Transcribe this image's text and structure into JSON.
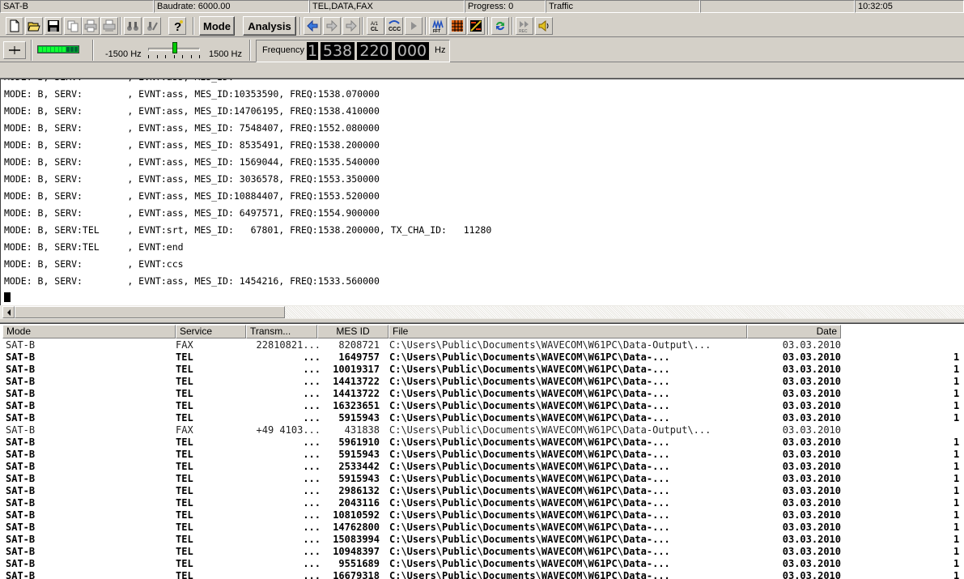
{
  "status": {
    "mode": "SAT-B",
    "baudrate": "Baudrate: 6000.00",
    "services": "TEL,DATA,FAX",
    "progress": "Progress: 0",
    "traffic": "Traffic",
    "blank": "",
    "time": "10:32:05"
  },
  "toolbar": {
    "mode_label": "Mode",
    "analysis_label": "Analysis",
    "icons": [
      "new-file-icon",
      "open-folder-icon",
      "save-icon",
      "copy-icon",
      "print-icon",
      "print-setup-icon",
      "binoculars-icon",
      "find-next-icon",
      "help-icon",
      "arrow-left-icon",
      "arrow-right-icon",
      "clear-icon",
      "ccc-icon",
      "play-icon",
      "fft-icon",
      "grid-icon",
      "sync-icon",
      "refresh-icon",
      "rec-icon",
      "speaker-icon"
    ]
  },
  "tuning": {
    "min_hz": "-1500 Hz",
    "max_hz": "1500 Hz",
    "offset_level": 0.52,
    "signal_level": 0.7,
    "frequency_label": "Frequency",
    "digits": [
      "1",
      "538",
      "220",
      "000"
    ],
    "unit": "Hz"
  },
  "output": {
    "lines": [
      "MODE: B, SERV:        , EVNT:ass, MES_ID:10353590, FREQ:1538.070000",
      "MODE: B, SERV:        , EVNT:ass, MES_ID:14706195, FREQ:1538.410000",
      "MODE: B, SERV:        , EVNT:ass, MES_ID: 7548407, FREQ:1552.080000",
      "MODE: B, SERV:        , EVNT:ass, MES_ID: 8535491, FREQ:1538.200000",
      "MODE: B, SERV:        , EVNT:ass, MES_ID: 1569044, FREQ:1535.540000",
      "MODE: B, SERV:        , EVNT:ass, MES_ID: 3036578, FREQ:1553.350000",
      "MODE: B, SERV:        , EVNT:ass, MES_ID:10884407, FREQ:1553.520000",
      "MODE: B, SERV:        , EVNT:ass, MES_ID: 6497571, FREQ:1554.900000",
      "MODE: B, SERV:TEL     , EVNT:srt, MES_ID:   67801, FREQ:1538.200000, TX_CHA_ID:   11280",
      "MODE: B, SERV:TEL     , EVNT:end",
      "MODE: B, SERV:        , EVNT:ccs",
      "MODE: B, SERV:        , EVNT:ass, MES_ID: 1454216, FREQ:1533.560000"
    ]
  },
  "table": {
    "columns": [
      "Mode",
      "Service",
      "Transm...",
      "MES ID",
      "File",
      "Date"
    ],
    "rows": [
      {
        "mode": "SAT-B",
        "service": "FAX",
        "trans": "22810821...",
        "mes": "8208721",
        "file": "C:\\Users\\Public\\Documents\\WAVECOM\\W61PC\\Data-Output\\...",
        "date": "03.03.2010",
        "extra": "",
        "bold": false
      },
      {
        "mode": "SAT-B",
        "service": "TEL",
        "trans": "...",
        "mes": "1649757",
        "file": "C:\\Users\\Public\\Documents\\WAVECOM\\W61PC\\Data-...",
        "date": "03.03.2010",
        "extra": "1",
        "bold": true
      },
      {
        "mode": "SAT-B",
        "service": "TEL",
        "trans": "...",
        "mes": "10019317",
        "file": "C:\\Users\\Public\\Documents\\WAVECOM\\W61PC\\Data-...",
        "date": "03.03.2010",
        "extra": "1",
        "bold": true
      },
      {
        "mode": "SAT-B",
        "service": "TEL",
        "trans": "...",
        "mes": "14413722",
        "file": "C:\\Users\\Public\\Documents\\WAVECOM\\W61PC\\Data-...",
        "date": "03.03.2010",
        "extra": "1",
        "bold": true
      },
      {
        "mode": "SAT-B",
        "service": "TEL",
        "trans": "...",
        "mes": "14413722",
        "file": "C:\\Users\\Public\\Documents\\WAVECOM\\W61PC\\Data-...",
        "date": "03.03.2010",
        "extra": "1",
        "bold": true
      },
      {
        "mode": "SAT-B",
        "service": "TEL",
        "trans": "...",
        "mes": "16323651",
        "file": "C:\\Users\\Public\\Documents\\WAVECOM\\W61PC\\Data-...",
        "date": "03.03.2010",
        "extra": "1",
        "bold": true
      },
      {
        "mode": "SAT-B",
        "service": "TEL",
        "trans": "...",
        "mes": "5915943",
        "file": "C:\\Users\\Public\\Documents\\WAVECOM\\W61PC\\Data-...",
        "date": "03.03.2010",
        "extra": "1",
        "bold": true
      },
      {
        "mode": "SAT-B",
        "service": "FAX",
        "trans": "+49 4103...",
        "mes": "431838",
        "file": "C:\\Users\\Public\\Documents\\WAVECOM\\W61PC\\Data-Output\\...",
        "date": "03.03.2010",
        "extra": "",
        "bold": false
      },
      {
        "mode": "SAT-B",
        "service": "TEL",
        "trans": "...",
        "mes": "5961910",
        "file": "C:\\Users\\Public\\Documents\\WAVECOM\\W61PC\\Data-...",
        "date": "03.03.2010",
        "extra": "1",
        "bold": true
      },
      {
        "mode": "SAT-B",
        "service": "TEL",
        "trans": "...",
        "mes": "5915943",
        "file": "C:\\Users\\Public\\Documents\\WAVECOM\\W61PC\\Data-...",
        "date": "03.03.2010",
        "extra": "1",
        "bold": true
      },
      {
        "mode": "SAT-B",
        "service": "TEL",
        "trans": "...",
        "mes": "2533442",
        "file": "C:\\Users\\Public\\Documents\\WAVECOM\\W61PC\\Data-...",
        "date": "03.03.2010",
        "extra": "1",
        "bold": true
      },
      {
        "mode": "SAT-B",
        "service": "TEL",
        "trans": "...",
        "mes": "5915943",
        "file": "C:\\Users\\Public\\Documents\\WAVECOM\\W61PC\\Data-...",
        "date": "03.03.2010",
        "extra": "1",
        "bold": true
      },
      {
        "mode": "SAT-B",
        "service": "TEL",
        "trans": "...",
        "mes": "2986132",
        "file": "C:\\Users\\Public\\Documents\\WAVECOM\\W61PC\\Data-...",
        "date": "03.03.2010",
        "extra": "1",
        "bold": true
      },
      {
        "mode": "SAT-B",
        "service": "TEL",
        "trans": "...",
        "mes": "2043116",
        "file": "C:\\Users\\Public\\Documents\\WAVECOM\\W61PC\\Data-...",
        "date": "03.03.2010",
        "extra": "1",
        "bold": true
      },
      {
        "mode": "SAT-B",
        "service": "TEL",
        "trans": "...",
        "mes": "10810592",
        "file": "C:\\Users\\Public\\Documents\\WAVECOM\\W61PC\\Data-...",
        "date": "03.03.2010",
        "extra": "1",
        "bold": true
      },
      {
        "mode": "SAT-B",
        "service": "TEL",
        "trans": "...",
        "mes": "14762800",
        "file": "C:\\Users\\Public\\Documents\\WAVECOM\\W61PC\\Data-...",
        "date": "03.03.2010",
        "extra": "1",
        "bold": true
      },
      {
        "mode": "SAT-B",
        "service": "TEL",
        "trans": "...",
        "mes": "15083994",
        "file": "C:\\Users\\Public\\Documents\\WAVECOM\\W61PC\\Data-...",
        "date": "03.03.2010",
        "extra": "1",
        "bold": true
      },
      {
        "mode": "SAT-B",
        "service": "TEL",
        "trans": "...",
        "mes": "10948397",
        "file": "C:\\Users\\Public\\Documents\\WAVECOM\\W61PC\\Data-...",
        "date": "03.03.2010",
        "extra": "1",
        "bold": true
      },
      {
        "mode": "SAT-B",
        "service": "TEL",
        "trans": "...",
        "mes": "9551689",
        "file": "C:\\Users\\Public\\Documents\\WAVECOM\\W61PC\\Data-...",
        "date": "03.03.2010",
        "extra": "1",
        "bold": true
      },
      {
        "mode": "SAT-B",
        "service": "TEL",
        "trans": "...",
        "mes": "16679318",
        "file": "C:\\Users\\Public\\Documents\\WAVECOM\\W61PC\\Data-...",
        "date": "03.03.2010",
        "extra": "1",
        "bold": true
      }
    ]
  }
}
